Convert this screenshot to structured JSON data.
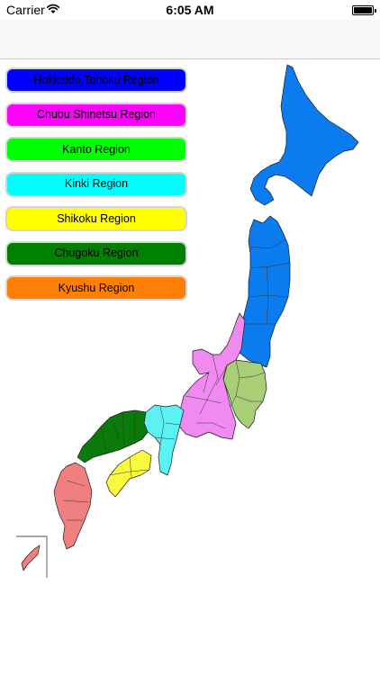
{
  "status_bar": {
    "carrier": "Carrier",
    "time": "6:05 AM",
    "wifi_icon": "wifi-icon",
    "battery_icon": "battery-icon",
    "battery_level": 1.0
  },
  "regions": [
    {
      "label": "Hokkaido,Tohoku Region",
      "color": "#0000ff"
    },
    {
      "label": "Chubu Shinetsu Region",
      "color": "#ff00ff"
    },
    {
      "label": "Kanto Region",
      "color": "#00ff00"
    },
    {
      "label": "Kinki Region",
      "color": "#00ffff"
    },
    {
      "label": "Shikoku Region",
      "color": "#ffff00"
    },
    {
      "label": "Chugoku Region",
      "color": "#008000"
    },
    {
      "label": "Kyushu Region",
      "color": "#ff8000"
    }
  ],
  "map_colors": {
    "hokkaido_tohoku": "#0a7cf0",
    "chubu": "#f08af0",
    "kanto": "#a8cf78",
    "kinki": "#5af2f2",
    "shikoku": "#fafa3c",
    "chugoku": "#0a7a0a",
    "kyushu": "#f08080"
  }
}
